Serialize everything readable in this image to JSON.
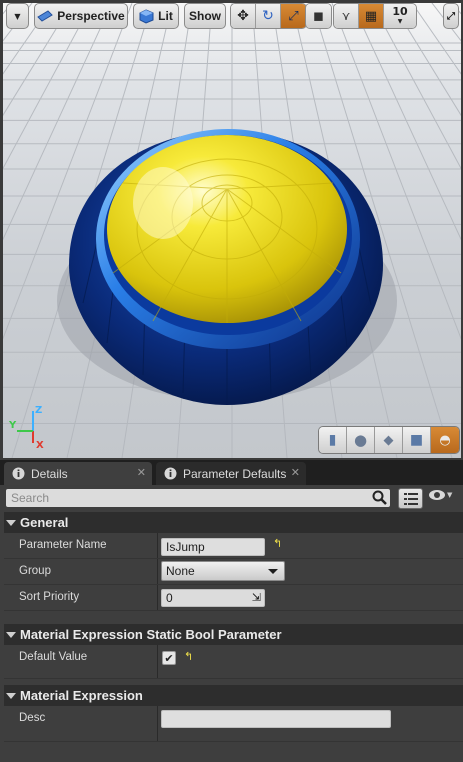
{
  "toolbar": {
    "perspective_label": "Perspective",
    "lit_label": "Lit",
    "show_label": "Show",
    "grid_value": "10"
  },
  "viewport": {
    "axis_labels": {
      "x": "X",
      "y": "Y",
      "z": "Z"
    },
    "colors": {
      "dome": "#f2e218",
      "base": "#0a2d7a",
      "ring": "#2f86f0",
      "accent_active": "#c7772a"
    }
  },
  "tabs": [
    {
      "label": "Details",
      "icon": "info-icon"
    },
    {
      "label": "Parameter Defaults",
      "icon": "info-icon"
    }
  ],
  "search": {
    "placeholder": "Search",
    "value": ""
  },
  "categories": [
    {
      "title": "General",
      "rows": [
        {
          "name": "Parameter Name",
          "value": "IsJump"
        },
        {
          "name": "Group",
          "value": "None"
        },
        {
          "name": "Sort Priority",
          "value": "0"
        }
      ]
    },
    {
      "title": "Material Expression Static Bool Parameter",
      "rows": [
        {
          "name": "Default Value",
          "value": "checked"
        }
      ]
    },
    {
      "title": "Material Expression",
      "rows": [
        {
          "name": "Desc",
          "value": ""
        }
      ]
    }
  ]
}
